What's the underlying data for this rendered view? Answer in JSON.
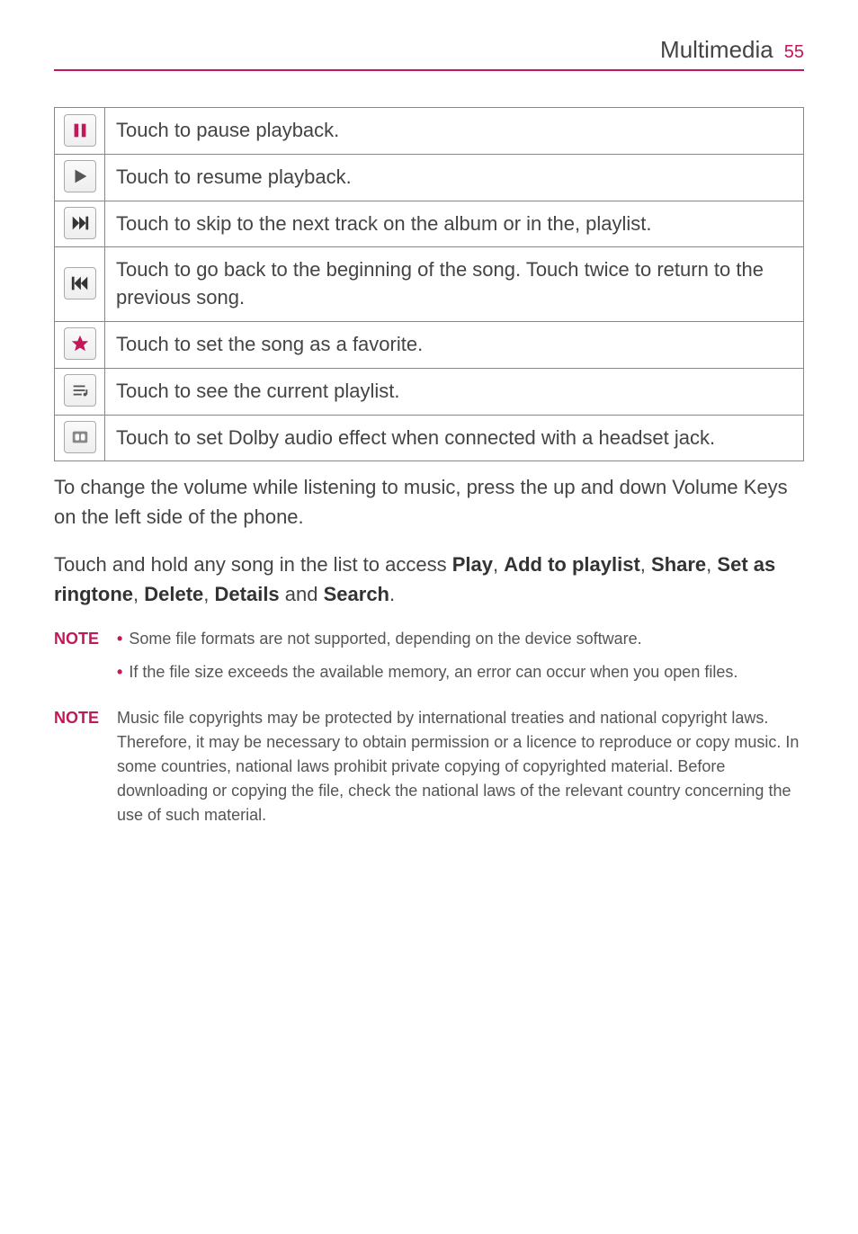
{
  "header": {
    "title": "Multimedia",
    "page": "55"
  },
  "table": {
    "rows": [
      {
        "desc": "Touch to pause playback."
      },
      {
        "desc": "Touch to resume playback."
      },
      {
        "desc": "Touch to skip to the next track on the album or in the, playlist."
      },
      {
        "desc": "Touch to go back to the beginning of the song. Touch twice to return to the previous song."
      },
      {
        "desc": "Touch to set the song as a favorite."
      },
      {
        "desc": "Touch to see the current playlist."
      },
      {
        "desc": "Touch to set Dolby audio effect when connected with a headset jack."
      }
    ]
  },
  "para1": "To change the volume while listening to music, press the up and down Volume Keys on the left side of the phone.",
  "para2": {
    "pre": "Touch and hold any song in the list to access ",
    "b1": "Play",
    "s1": ", ",
    "b2": "Add to playlist",
    "s2": ", ",
    "b3": "Share",
    "s3": ", ",
    "b4": "Set as ringtone",
    "s4": ", ",
    "b5": "Delete",
    "s5": ", ",
    "b6": "Details",
    "s6": " and ",
    "b7": "Search",
    "s7": "."
  },
  "notes": [
    {
      "label": "NOTE",
      "lines": [
        "Some file formats are not supported, depending on the device software.",
        "If the file size exceeds the available memory, an error can occur when you open files."
      ],
      "bulleted": true
    },
    {
      "label": "NOTE",
      "lines": [
        "Music file copyrights may be protected by international treaties and national copyright laws. Therefore, it may be necessary to obtain permission or a licence to reproduce or copy music. In some countries, national laws prohibit private copying of copyrighted material. Before downloading or copying the file, check the national laws of the relevant country concerning the use of such material."
      ],
      "bulleted": false
    }
  ]
}
